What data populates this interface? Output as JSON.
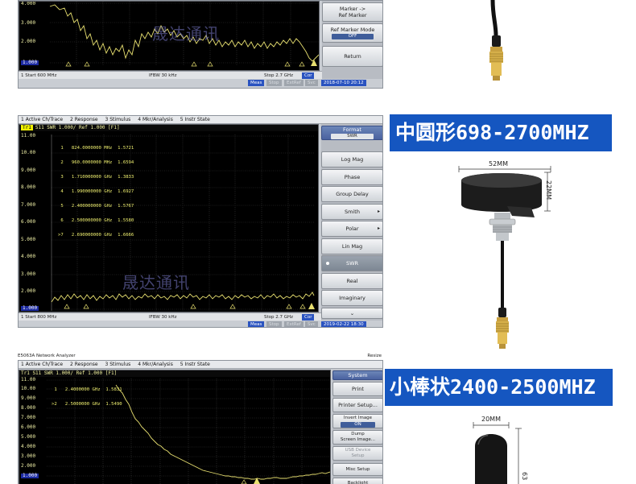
{
  "watermark": "晟达通讯",
  "panel1": {
    "y_labels": [
      "4.000",
      "3.000",
      "2.000",
      "1.000"
    ],
    "status": {
      "start": "1  Start 600 MHz",
      "ifbw": "IFBW 30 kHz",
      "stop": "Stop 2.7 GHz",
      "cor": "Cor"
    },
    "status2": {
      "meas": "Meas",
      "stop": "Stop",
      "extref": "ExtRef",
      "svc": "Svc",
      "datetime": "2018-07-10 20:12"
    },
    "softkeys": {
      "marker_to_ref": "Marker ->\nRef Marker",
      "ref_marker_mode": "Ref Marker Mode",
      "ref_marker_mode_value": "OFF",
      "return": "Return"
    }
  },
  "panel2": {
    "menu": [
      "1 Active Ch/Trace",
      "2 Response",
      "3 Stimulus",
      "4 Mkr/Analysis",
      "5 Instr State"
    ],
    "trace_header_tag": "Tr1",
    "trace_header": "S11  SWR 1.000/ Ref 1.000  [F1]",
    "y_labels": [
      "11.00",
      "10.00",
      "9.000",
      "8.000",
      "7.000",
      "6.000",
      "5.000",
      "4.000",
      "3.000",
      "2.000",
      "1.000"
    ],
    "markers": [
      " 1   824.0000000 MHz  1.5721",
      " 2   960.0000000 MHz  1.6594",
      " 3   1.710000000 GHz  1.3833",
      " 4   1.990000000 GHz  1.6927",
      " 5   2.400000000 GHz  1.5767",
      " 6   2.500000000 GHz  1.5580",
      ">7   2.690000000 GHz  1.6666"
    ],
    "status": {
      "start": "1  Start 800 MHz",
      "ifbw": "IFBW 30 kHz",
      "stop": "Stop 2.7 GHz",
      "cor": "Cor"
    },
    "status2": {
      "meas": "Meas",
      "stop": "Stop",
      "extref": "ExtRef",
      "svc": "Svc",
      "datetime": "2019-02-22 18:30"
    },
    "softkeys": {
      "format": "Format",
      "format_value": "SWR",
      "items": [
        "Log Mag",
        "Phase",
        "Group Delay",
        "Smith",
        "Polar",
        "Lin Mag",
        "SWR",
        "Real",
        "Imaginary"
      ]
    }
  },
  "panel3": {
    "title": "E5063A Network Analyzer",
    "resize": "Resize",
    "menu": [
      "1 Active Ch/Trace",
      "2 Response",
      "3 Stimulus",
      "4 Mkr/Analysis",
      "5 Instr State"
    ],
    "trace_header": "Tr1  S11  SWR 1.000/ Ref 1.000  [F1]",
    "y_labels": [
      "11.00",
      "10.00",
      "9.000",
      "8.000",
      "7.000",
      "6.000",
      "5.000",
      "4.000",
      "3.000",
      "2.000",
      "1.000"
    ],
    "markers": [
      " 1   2.4000000 GHz  1.5831",
      ">2   2.5000000 GHz  1.5490"
    ],
    "softkeys": {
      "system": "System",
      "print": "Print",
      "printer_setup": "Printer Setup...",
      "invert_image": "Invert Image",
      "invert_image_value": "ON",
      "dump": "Dump\nScreen Image...",
      "usb": "USB Device\nSetup",
      "misc": "Misc Setup",
      "backlight": "Backlight"
    }
  },
  "product2": {
    "band_label": "中圆形698-2700MHZ",
    "width_label": "52MM",
    "height_label": "22MM"
  },
  "product3": {
    "band_label": "小棒状2400-2500MHZ",
    "width_label": "20MM",
    "height_label": "63"
  }
}
